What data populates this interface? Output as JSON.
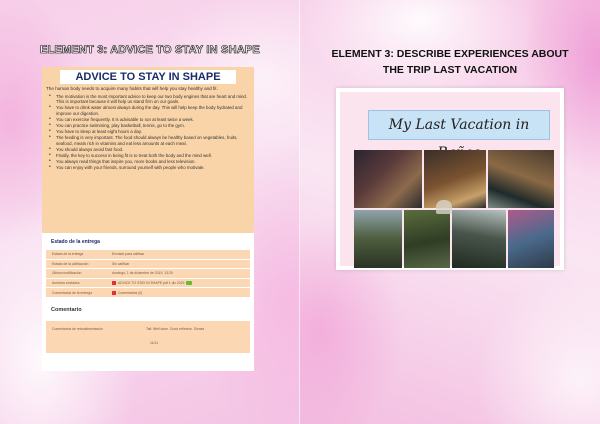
{
  "left_page": {
    "heading": "ELEMENT 3: ADVICE TO STAY IN SHAPE",
    "doc": {
      "title": "ADVICE TO STAY IN SHAPE",
      "intro": "The human body needs to acquire many habits that will help you stay healthy and fit.",
      "items": [
        "The motivation is the most important advice to keep our two body engines that are heart and mind. This is important because it will help us stand firm on our goals.",
        "You have to drink water almost always during the day. This will help keep the body hydrated and improve our digestion.",
        "You can exercise frequently. It is advisable to run at least twice a week.",
        "You can practice swimming, play basketball, tennis, go to the gym.",
        "You have to sleep at least eight hours a day.",
        "The feeding is very important. The food should always be healthy based on vegetables, fruits, seafood, meats rich in vitamins and eat less amounts at each meal.",
        "You should always avoid fast food.",
        "Finally, the key to success in being fit is to treat both the body and the mind well.",
        "You always read things that inspire you, more books and less television.",
        "You can enjoy with your friends, surround yourself with people who motivate."
      ]
    },
    "panel": {
      "title": "Estado de la entrega",
      "rows": [
        {
          "key": "Estado de la entrega",
          "value": "Enviado para calificar"
        },
        {
          "key": "Estado de la calificación",
          "value": "Sin calificar"
        },
        {
          "key": "Última modificación",
          "value": "domingo, 1 de diciembre de 2019, 13:29"
        },
        {
          "key": "Archivos enviados",
          "value": "ADVICE TO STAY IN SHAPE.pdf  1 dic 2019"
        },
        {
          "key": "Comentarios de la entrega",
          "value": "Comentarios (0)"
        }
      ],
      "comment_title": "Comentario",
      "comment_key": "Comentarios de retroalimentación",
      "comment_value": "Tail: Well done. Good reflexion. Sinnes",
      "comment_footer": "11/11"
    }
  },
  "right_page": {
    "heading": "ELEMENT 3: DESCRIBE EXPERIENCES ABOUT THE TRIP LAST VACATION",
    "banner": "My Last Vacation in Baños"
  },
  "colors": {
    "accent_peach": "#f9d4a8",
    "title_blue": "#1b2a6b",
    "banner_blue": "#c8e3f6",
    "background_pink": "#f7cfe9"
  }
}
